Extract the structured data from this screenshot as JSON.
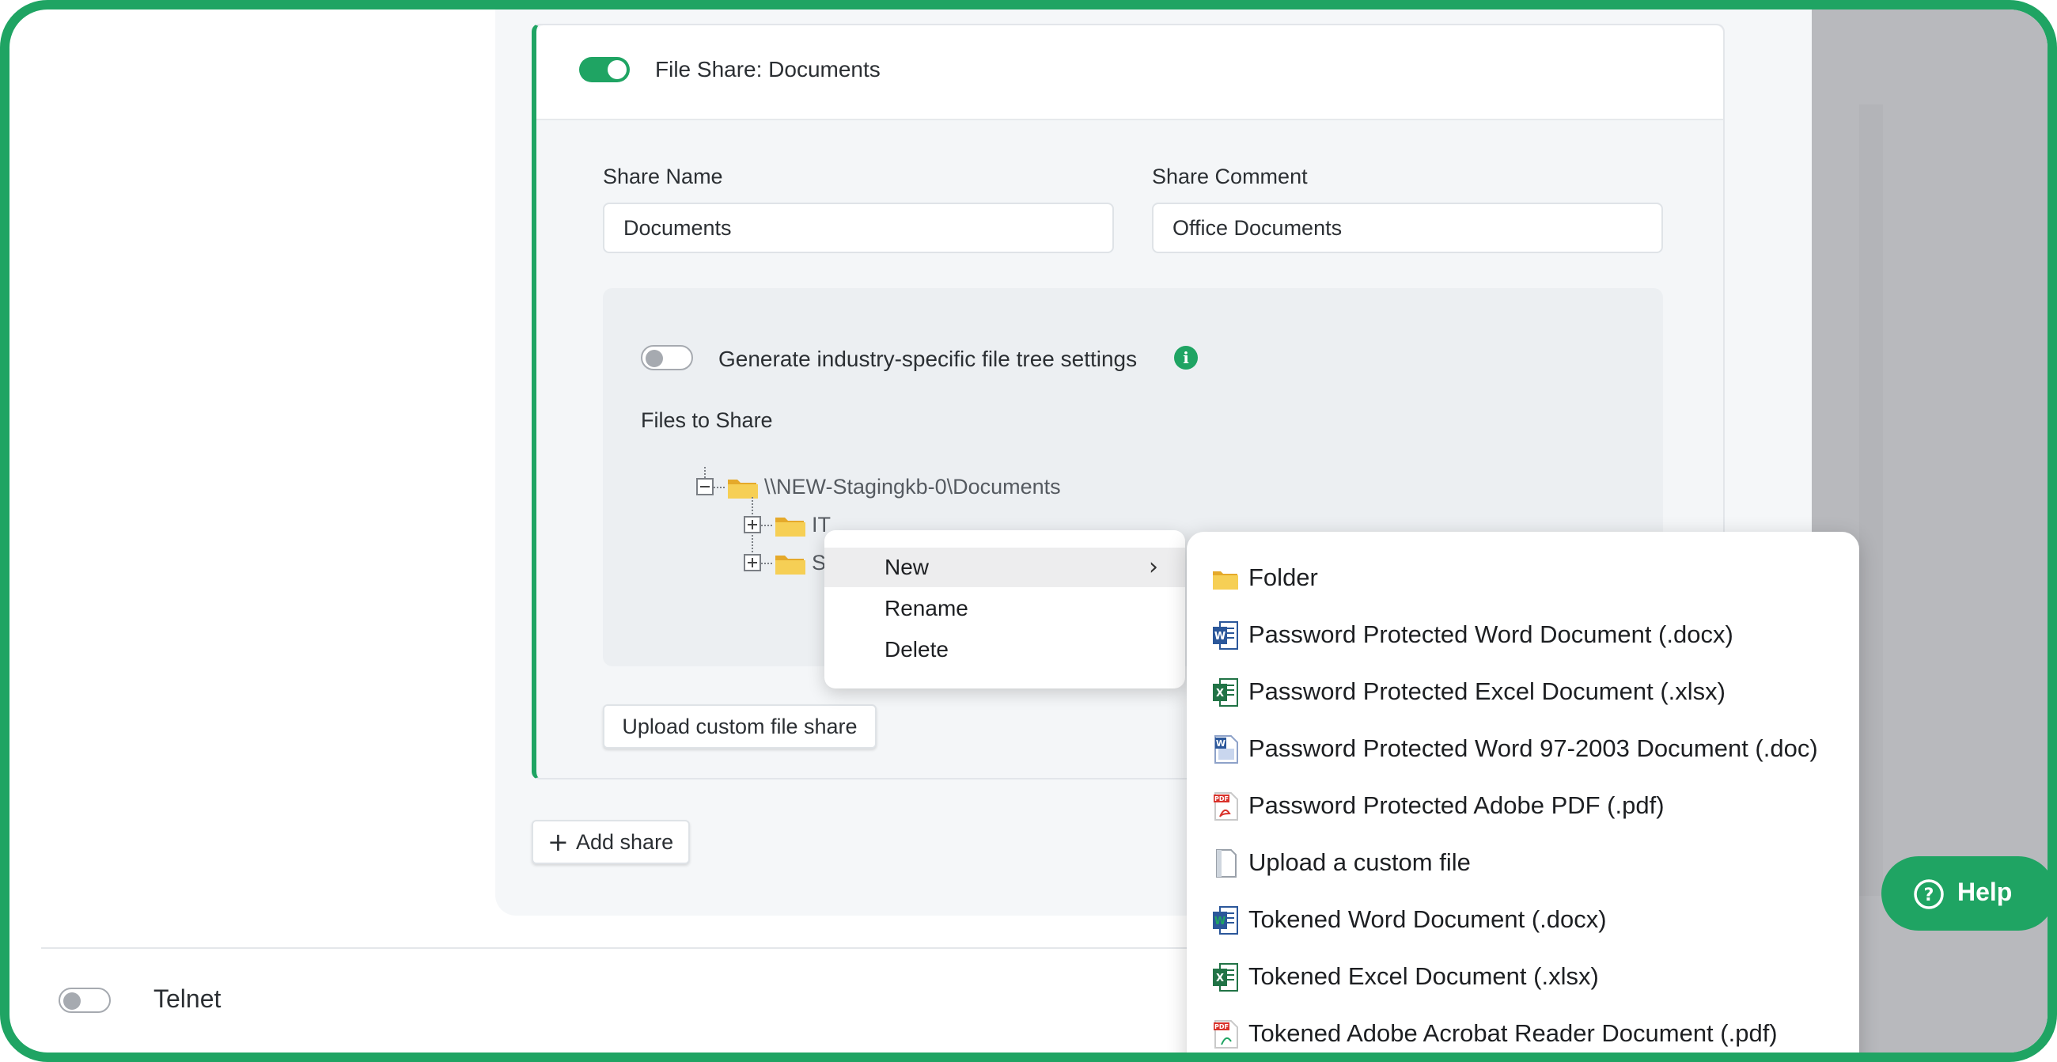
{
  "share": {
    "title": "File Share: Documents",
    "enabled": true,
    "share_name_label": "Share Name",
    "share_name_value": "Documents",
    "share_comment_label": "Share Comment",
    "share_comment_value": "Office Documents",
    "industry_toggle_label": "Generate industry-specific file tree settings",
    "industry_toggle_enabled": false,
    "files_label": "Files to Share",
    "tree": {
      "root": "\\\\NEW-Stagingkb-0\\Documents",
      "children": [
        "IT",
        "S"
      ]
    },
    "upload_button": "Upload custom file share"
  },
  "add_share_button": "Add share",
  "context_menu": {
    "items": [
      "New",
      "Rename",
      "Delete"
    ]
  },
  "submenu": {
    "items": [
      {
        "label": "Folder",
        "icon": "folder-icon"
      },
      {
        "label": "Password Protected Word Document (.docx)",
        "icon": "word-icon"
      },
      {
        "label": "Password Protected Excel Document (.xlsx)",
        "icon": "excel-icon"
      },
      {
        "label": "Password Protected Word 97-2003 Document (.doc)",
        "icon": "word-legacy-icon"
      },
      {
        "label": "Password Protected Adobe PDF (.pdf)",
        "icon": "pdf-icon"
      },
      {
        "label": "Upload a custom file",
        "icon": "blank-file-icon"
      },
      {
        "label": "Tokened Word Document (.docx)",
        "icon": "word-icon"
      },
      {
        "label": "Tokened Excel Document (.xlsx)",
        "icon": "excel-icon"
      },
      {
        "label": "Tokened Adobe Acrobat Reader Document (.pdf)",
        "icon": "pdf-icon"
      }
    ]
  },
  "telnet": {
    "label": "Telnet",
    "enabled": false
  },
  "help": {
    "label": "Help"
  },
  "colors": {
    "accent": "#1fa463",
    "overlay": "#b8b9bd"
  }
}
